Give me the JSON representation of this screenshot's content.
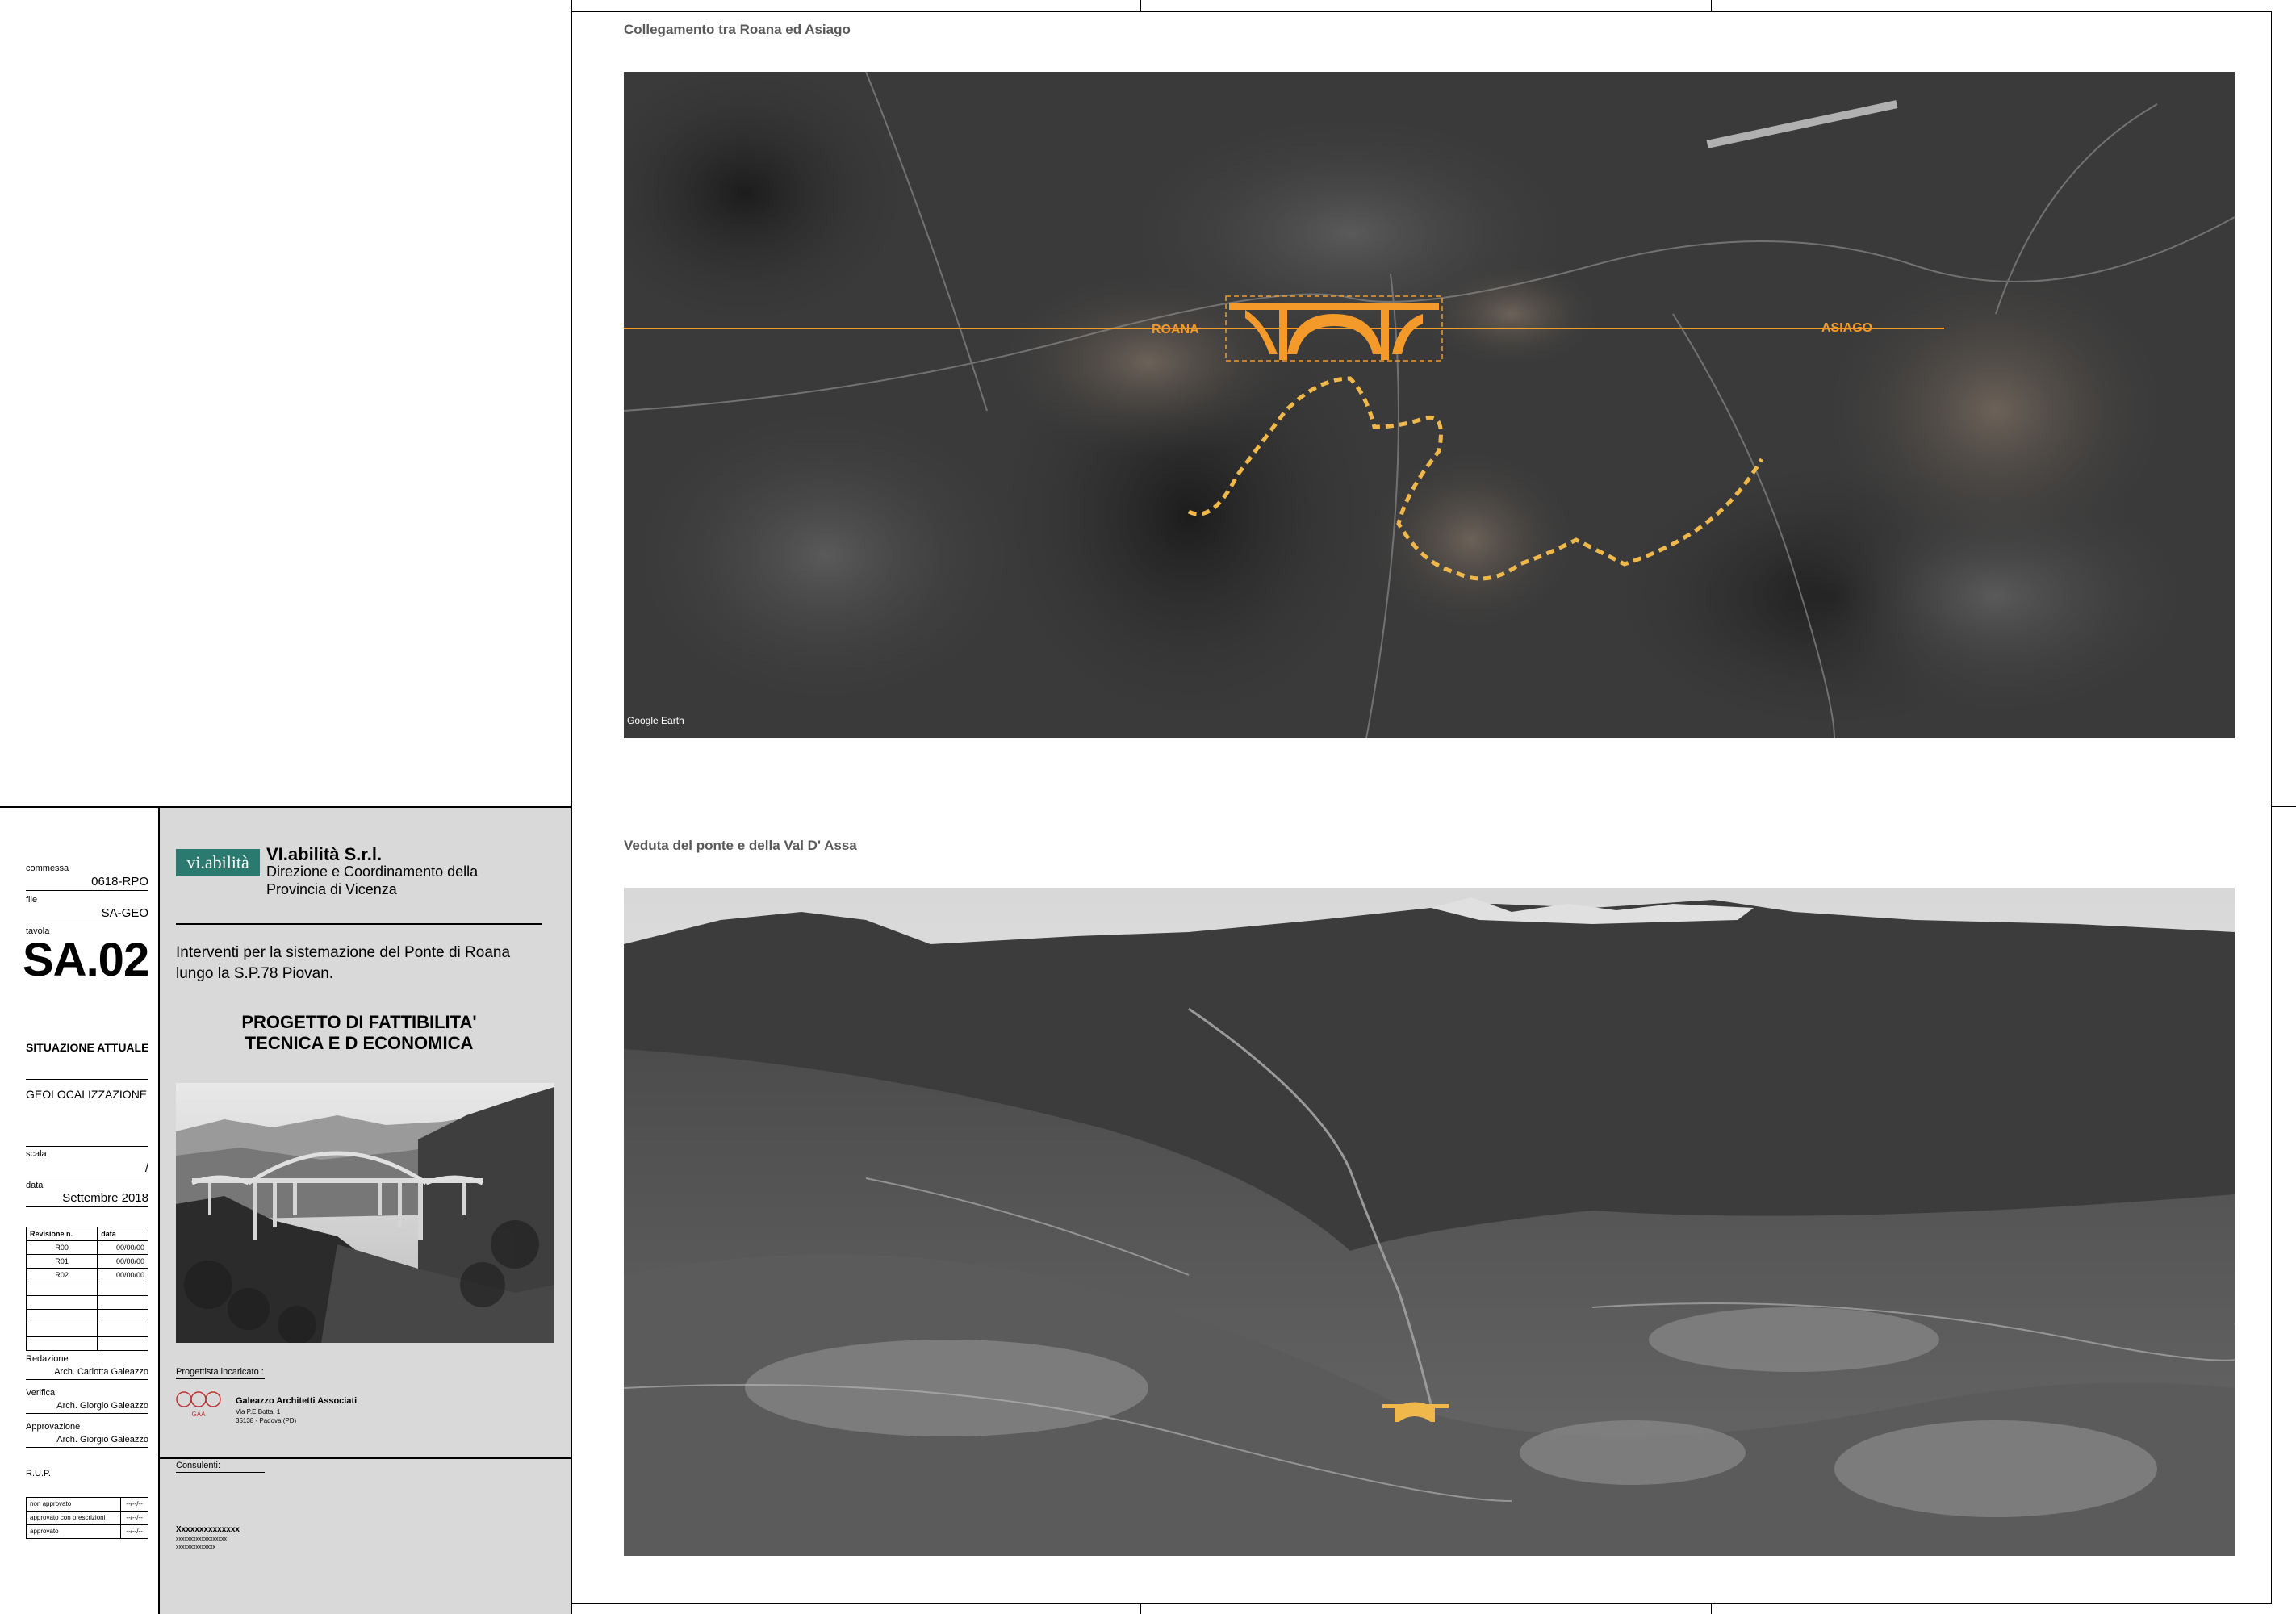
{
  "colors": {
    "accent": "#f39a2b",
    "brand": "#2b7a6f",
    "panel": "#d9d9d9"
  },
  "map": {
    "title": "Collegamento tra Roana ed Asiago",
    "label_left": "ROANA",
    "label_right": "ASIAGO",
    "credit": "Google Earth"
  },
  "view": {
    "title": "Veduta del ponte e della Val D' Assa"
  },
  "left": {
    "commessa_label": "commessa",
    "commessa_value": "0618-RPO",
    "file_label": "file",
    "file_value": "SA-GEO",
    "tavola_label": "tavola",
    "tavola_value": "SA.02",
    "situazione": "SITUAZIONE ATTUALE",
    "geoloc": "GEOLOCALIZZAZIONE",
    "scala_label": "scala",
    "scala_value": "/",
    "data_label": "data",
    "data_value": "Settembre 2018",
    "revisions_header": [
      "Revisione n.",
      "data"
    ],
    "revisions": [
      [
        "R00",
        "00/00/00"
      ],
      [
        "R01",
        "00/00/00"
      ],
      [
        "R02",
        "00/00/00"
      ],
      [
        "",
        ""
      ],
      [
        "",
        ""
      ],
      [
        "",
        ""
      ],
      [
        "",
        ""
      ],
      [
        "",
        ""
      ]
    ],
    "redazione_label": "Redazione",
    "redazione_value": "Arch. Carlotta Galeazzo",
    "verifica_label": "Verifica",
    "verifica_value": "Arch. Giorgio Galeazzo",
    "approvazione_label": "Approvazione",
    "approvazione_value": "Arch. Giorgio Galeazzo",
    "rup_label": "R.U.P.",
    "rup_rows": [
      [
        "non approvato",
        "--/--/--"
      ],
      [
        "approvato con prescrizioni",
        "--/--/--"
      ],
      [
        "approvato",
        "--/--/--"
      ]
    ]
  },
  "client": {
    "logo_text": "vi.abilità",
    "company": "VI.abilità S.r.l.",
    "line2": "Direzione e Coordinamento della",
    "line3": "Provincia di Vicenza",
    "desc1": "Interventi per la sistemazione del Ponte di Roana",
    "desc2": "lungo la S.P.78 Piovan.",
    "project1": "PROGETTO DI FATTIBILITA'",
    "project2": "TECNICA E D ECONOMICA",
    "progettista_label": "Progettista incaricato :",
    "firm_name": "Galeazzo Architetti Associati",
    "firm_addr1": "Via P.E.Botta, 1",
    "firm_addr2": "35138 - Padova (PD)",
    "firm_logo_text": "GAA",
    "consulenti_label": "Consulenti:",
    "consulenti_name": "Xxxxxxxxxxxxxx",
    "consulenti_l1": "xxxxxxxxxxxxxxxxxx",
    "consulenti_l2": "xxxxxxxxxxxxxx"
  }
}
